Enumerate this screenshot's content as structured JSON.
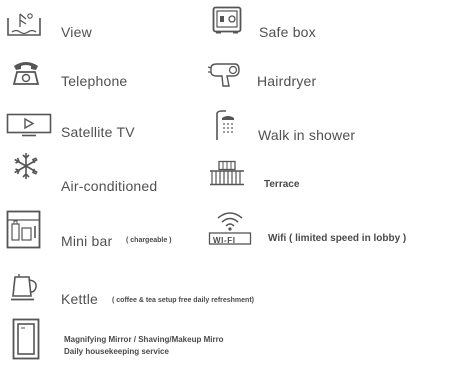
{
  "amenities": {
    "view": "View",
    "safe_box": "Safe box",
    "telephone": "Telephone",
    "hairdryer": "Hairdryer",
    "satellite_tv": "Satellite TV",
    "walk_in_shower": "Walk in shower",
    "air_conditioned": "Air-conditioned",
    "terrace": "Terrace",
    "mini_bar": "Mini bar",
    "mini_bar_note": "( chargeable )",
    "wifi": "Wifi ( limited speed in lobby )",
    "wifi_badge": "WI-FI",
    "kettle": "Kettle",
    "kettle_note": "( coffee & tea setup free daily refreshment)",
    "mirror_line1": "Magnifying Mirror / Shaving/Makeup Mirro",
    "mirror_line2": "Daily housekeeping service"
  },
  "icons": [
    "view-icon",
    "safe-icon",
    "telephone-icon",
    "hairdryer-icon",
    "tv-icon",
    "shower-icon",
    "snowflake-icon",
    "terrace-icon",
    "minibar-icon",
    "wifi-icon",
    "kettle-icon",
    "mirror-icon"
  ],
  "colors": {
    "icon_stroke": "#555555",
    "text": "#505050"
  }
}
